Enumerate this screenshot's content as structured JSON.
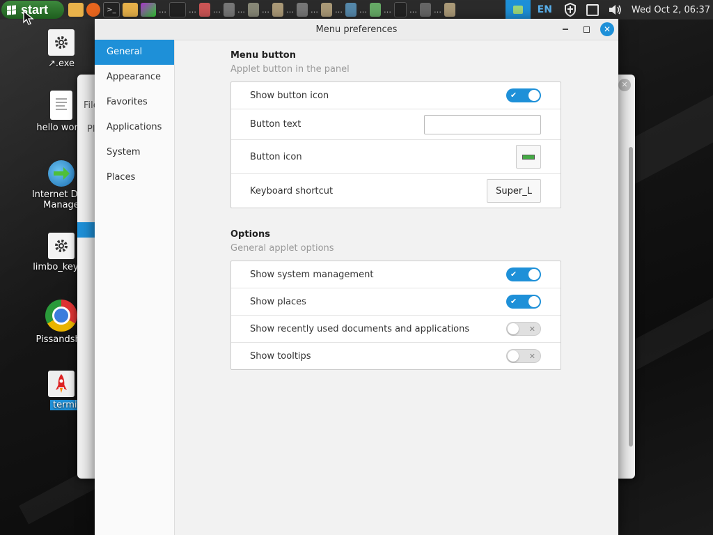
{
  "taskbar": {
    "start_label": "start",
    "language": "EN",
    "clock": "Wed Oct  2, 06:37"
  },
  "desktop_icons": [
    {
      "label": "↗.exe",
      "icon": "gear-icon"
    },
    {
      "label": "hello world",
      "icon": "document-icon"
    },
    {
      "label": "Internet Dow",
      "label2": "Manage",
      "icon": "download-manager-icon"
    },
    {
      "label": "limbo_keyge",
      "icon": "gear-icon"
    },
    {
      "label": "Pissandshit",
      "icon": "chrome-icon"
    },
    {
      "label": "termina",
      "icon": "rocket-icon"
    }
  ],
  "background_window": {
    "menu_partial": "File",
    "path_partial": "Pl"
  },
  "dialog": {
    "title": "Menu preferences",
    "sidebar": [
      {
        "label": "General",
        "selected": true
      },
      {
        "label": "Appearance",
        "selected": false
      },
      {
        "label": "Favorites",
        "selected": false
      },
      {
        "label": "Applications",
        "selected": false
      },
      {
        "label": "System",
        "selected": false
      },
      {
        "label": "Places",
        "selected": false
      }
    ],
    "menu_button": {
      "title": "Menu button",
      "subtitle": "Applet button in the panel",
      "show_button_icon_label": "Show button icon",
      "show_button_icon": true,
      "button_text_label": "Button text",
      "button_text_value": "",
      "button_icon_label": "Button icon",
      "keyboard_shortcut_label": "Keyboard shortcut",
      "keyboard_shortcut_value": "Super_L"
    },
    "options": {
      "title": "Options",
      "subtitle": "General applet options",
      "show_system_management_label": "Show system management",
      "show_system_management": true,
      "show_places_label": "Show places",
      "show_places": true,
      "show_recent_label": "Show recently used documents and applications",
      "show_recent": false,
      "show_tooltips_label": "Show tooltips",
      "show_tooltips": false
    }
  },
  "colors": {
    "accent": "#1e90d8",
    "start_green": "#2e7d2e"
  }
}
